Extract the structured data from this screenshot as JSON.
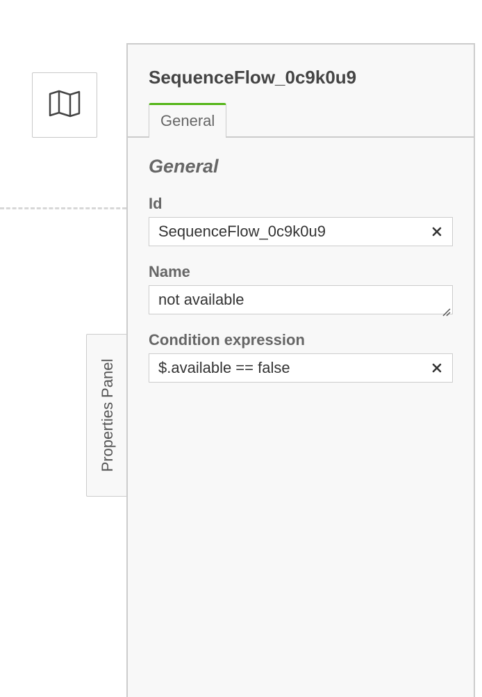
{
  "minimap": {
    "icon": "map-icon"
  },
  "toggle": {
    "label": "Properties Panel"
  },
  "panel": {
    "header_title": "SequenceFlow_0c9k0u9",
    "tabs": [
      {
        "label": "General",
        "active": true
      }
    ],
    "group_title": "General",
    "fields": {
      "id": {
        "label": "Id",
        "value": "SequenceFlow_0c9k0u9",
        "icon": "clear-icon"
      },
      "name": {
        "label": "Name",
        "value": "not available",
        "icon": "resize-handle-icon"
      },
      "condition": {
        "label": "Condition expression",
        "value": "$.available == false",
        "icon": "clear-icon"
      }
    }
  },
  "colors": {
    "accent": "#52b415",
    "panel_bg": "#f8f8f8",
    "border": "#cccccc",
    "label": "#666666"
  }
}
